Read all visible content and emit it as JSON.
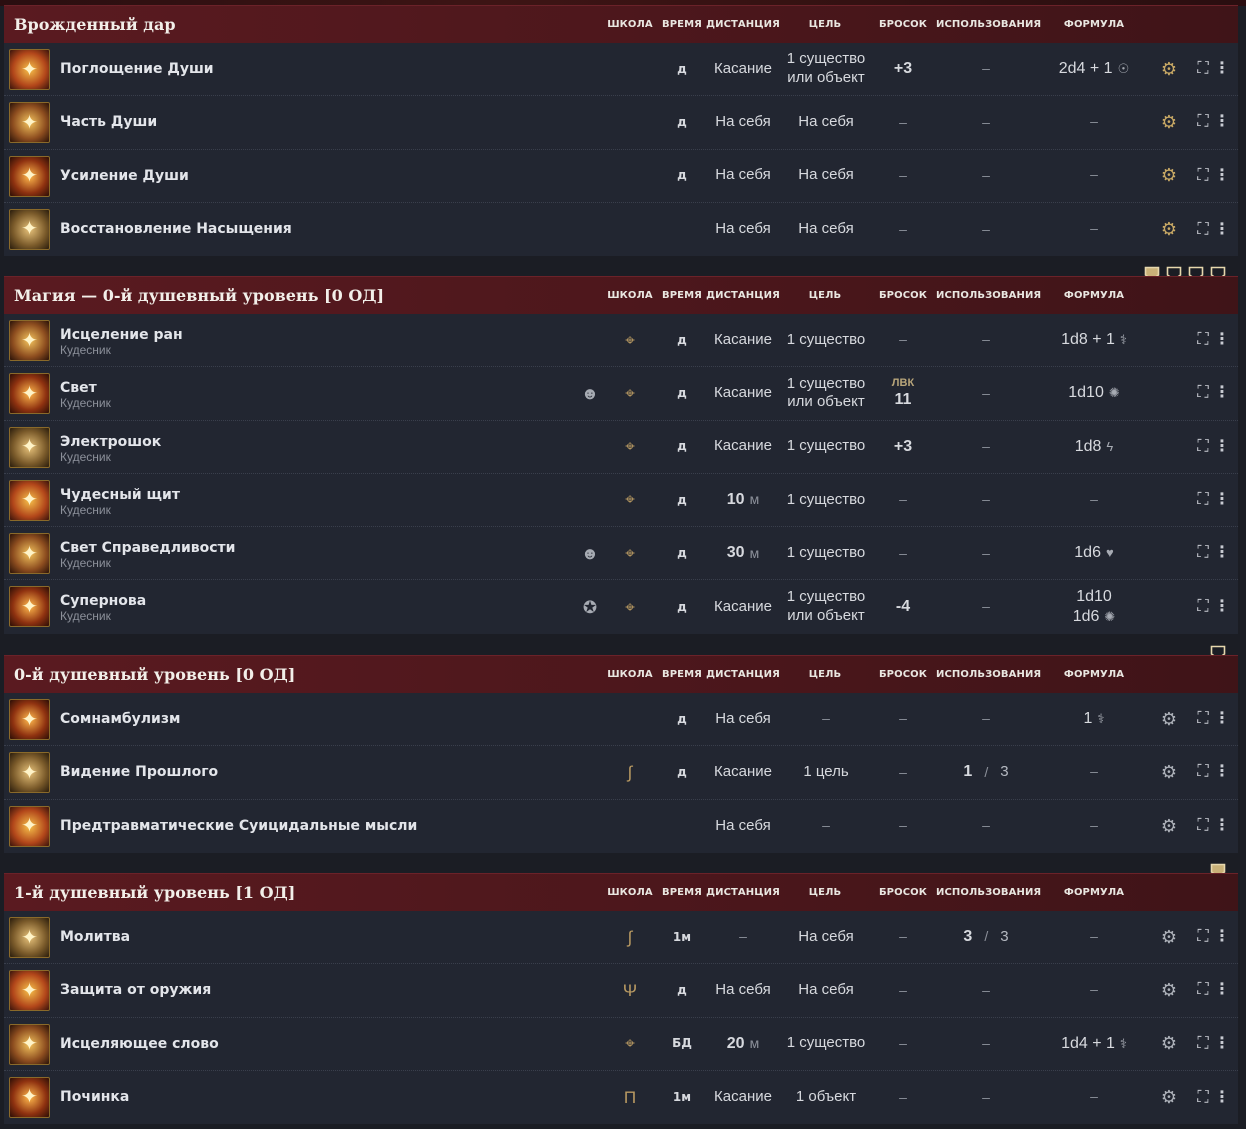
{
  "columns": {
    "school": "ШКОЛА",
    "time": "ВРЕМЯ",
    "range": "ДИСТАНЦИЯ",
    "target": "ЦЕЛЬ",
    "roll": "БРОСОК",
    "uses": "ИСПОЛЬЗОВАНИЯ",
    "formula": "ФОРМУЛА"
  },
  "sections": [
    {
      "title": "Врожденный дар",
      "rows": [
        {
          "name": "Поглощение Души",
          "time": "д",
          "range": "Касание",
          "target": "1 существо",
          "target2": "или объект",
          "roll": "+3",
          "uses": "–",
          "formula": "2d4 + 1",
          "formula_icon": "necrotic-icon",
          "gear": "gold"
        },
        {
          "name": "Часть Души",
          "time": "д",
          "range": "На себя",
          "target": "На себя",
          "roll": "–",
          "uses": "–",
          "formula": "–",
          "gear": "gold"
        },
        {
          "name": "Усиление Души",
          "time": "д",
          "range": "На себя",
          "target": "На себя",
          "roll": "–",
          "uses": "–",
          "formula": "–",
          "gear": "gold"
        },
        {
          "name": "Восстановление Насыщения",
          "time": "",
          "range": "На себя",
          "target": "На себя",
          "roll": "–",
          "uses": "–",
          "formula": "–",
          "gear": "gold"
        }
      ]
    },
    {
      "title": "Магия — 0-й душевный уровень [0 ОД]",
      "slots_filled": 1,
      "slots_total": 4,
      "rows": [
        {
          "name": "Исцеление ран",
          "sub": "Кудесник",
          "school_icon": "evocation-icon",
          "time": "д",
          "range": "Касание",
          "target": "1 существо",
          "roll": "–",
          "uses": "–",
          "formula": "1d8 + 1",
          "formula_icon": "healing-icon"
        },
        {
          "name": "Свет",
          "sub": "Кудесник",
          "conc": true,
          "school_icon": "evocation-icon",
          "time": "д",
          "range": "Касание",
          "target": "1 существо",
          "target2": "или объект",
          "roll_label": "ЛВК",
          "roll": "11",
          "uses": "–",
          "formula": "1d10",
          "formula_icon": "radiant-icon"
        },
        {
          "name": "Электрошок",
          "sub": "Кудесник",
          "school_icon": "evocation-icon",
          "time": "д",
          "range": "Касание",
          "target": "1 существо",
          "roll": "+3",
          "uses": "–",
          "formula": "1d8",
          "formula_icon": "lightning-icon"
        },
        {
          "name": "Чудесный щит",
          "sub": "Кудесник",
          "school_icon": "evocation-icon",
          "time": "д",
          "range_num": "10",
          "range_unit": "м",
          "target": "1 существо",
          "roll": "–",
          "uses": "–",
          "formula": "–"
        },
        {
          "name": "Свет Справедливости",
          "sub": "Кудесник",
          "conc": true,
          "school_icon": "evocation-icon",
          "time": "д",
          "range_num": "30",
          "range_unit": "м",
          "target": "1 существо",
          "roll": "–",
          "uses": "–",
          "formula": "1d6",
          "formula_icon": "psychic-icon"
        },
        {
          "name": "Супернова",
          "sub": "Кудесник",
          "ritual": true,
          "school_icon": "evocation-icon",
          "time": "д",
          "range": "Касание",
          "target": "1 существо",
          "target2": "или объект",
          "roll": "-4",
          "uses": "–",
          "formula": "1d10",
          "formula2": "1d6",
          "formula_icon": "radiant-icon"
        }
      ]
    },
    {
      "title": "0-й душевный уровень [0 ОД]",
      "slots_filled": 0,
      "slots_total": 1,
      "rows": [
        {
          "name": "Сомнамбулизм",
          "time": "д",
          "range": "На себя",
          "target": "–",
          "roll": "–",
          "uses": "–",
          "formula": "1",
          "formula_icon": "healing-icon",
          "gear": "grey"
        },
        {
          "name": "Видение Прошлого",
          "school_icon": "divination-icon",
          "time": "д",
          "range": "Касание",
          "target": "1 цель",
          "roll": "–",
          "uses_cur": "1",
          "uses_max": "3",
          "formula": "–",
          "gear": "grey"
        },
        {
          "name": "Предтравматические Суицидальные мысли",
          "time": "",
          "range": "На себя",
          "target": "–",
          "roll": "–",
          "uses": "–",
          "formula": "–",
          "gear": "grey"
        }
      ]
    },
    {
      "title": "1-й душевный уровень [1 ОД]",
      "slots_filled": 1,
      "slots_total": 1,
      "rows": [
        {
          "name": "Молитва",
          "school_icon": "divination-icon",
          "time": "1м",
          "range": "–",
          "target": "На себя",
          "roll": "–",
          "uses_cur": "3",
          "uses_max": "3",
          "formula": "–",
          "gear": "grey"
        },
        {
          "name": "Защита от оружия",
          "school_icon": "abjuration-icon",
          "time": "д",
          "range": "На себя",
          "target": "На себя",
          "roll": "–",
          "uses": "–",
          "formula": "–",
          "gear": "grey"
        },
        {
          "name": "Исцеляющее слово",
          "school_icon": "evocation-icon",
          "time": "БД",
          "range_num": "20",
          "range_unit": "м",
          "target": "1 существо",
          "roll": "–",
          "uses": "–",
          "formula": "1d4 + 1",
          "formula_icon": "healing-icon",
          "gear": "grey"
        },
        {
          "name": "Починка",
          "school_icon": "transmutation-icon",
          "time": "1м",
          "range": "Касание",
          "target": "1 объект",
          "roll": "–",
          "uses": "–",
          "formula": "–",
          "gear": "grey"
        }
      ]
    }
  ],
  "icon_colors": {
    "gold": "#c9a965",
    "accent": "#5a1a20",
    "row_bg": "#222631"
  }
}
